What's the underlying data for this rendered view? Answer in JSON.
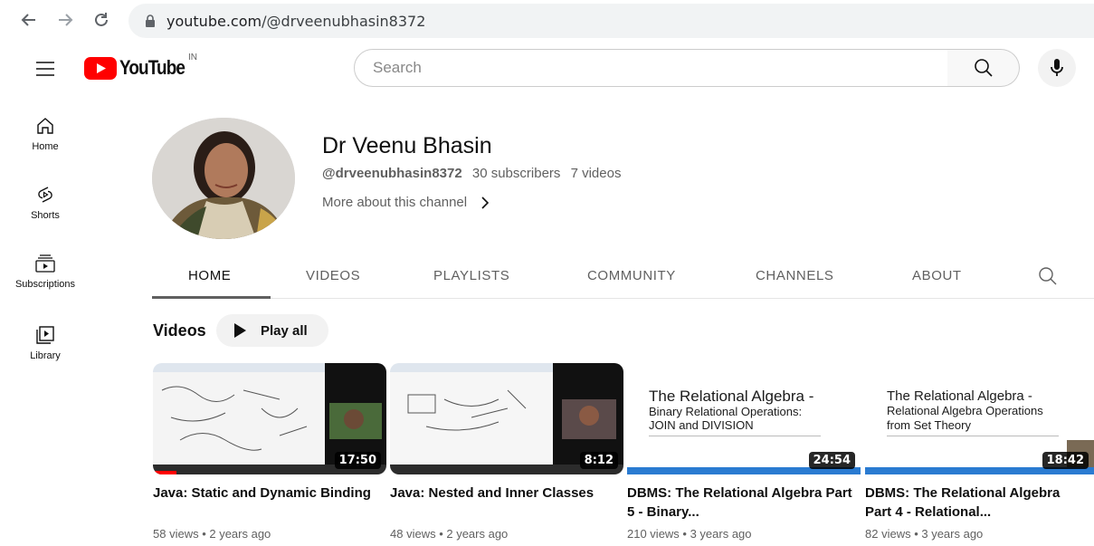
{
  "browser": {
    "url_host": "youtube.com",
    "url_path": "/@drveenubhasin8372"
  },
  "header": {
    "logo_text": "YouTube",
    "country": "IN",
    "search_placeholder": "Search"
  },
  "sidebar": {
    "items": [
      {
        "label": "Home",
        "icon": "home-icon"
      },
      {
        "label": "Shorts",
        "icon": "shorts-icon"
      },
      {
        "label": "Subscriptions",
        "icon": "subscriptions-icon"
      },
      {
        "label": "Library",
        "icon": "library-icon"
      }
    ]
  },
  "channel": {
    "name": "Dr Veenu Bhasin",
    "handle": "@drveenubhasin8372",
    "subscribers": "30 subscribers",
    "videos": "7 videos",
    "more_about": "More about this channel"
  },
  "tabs": [
    {
      "label": "HOME",
      "active": true
    },
    {
      "label": "VIDEOS",
      "active": false
    },
    {
      "label": "PLAYLISTS",
      "active": false
    },
    {
      "label": "COMMUNITY",
      "active": false
    },
    {
      "label": "CHANNELS",
      "active": false
    },
    {
      "label": "ABOUT",
      "active": false
    }
  ],
  "shelf": {
    "title": "Videos",
    "play_all": "Play all"
  },
  "videos": [
    {
      "title": "Java: Static and Dynamic Binding",
      "duration": "17:50",
      "meta": "58 views • 2 years ago",
      "progress": 0.1
    },
    {
      "title": "Java: Nested and Inner Classes",
      "duration": "8:12",
      "meta": "48 views • 2 years ago"
    },
    {
      "title": "DBMS: The Relational Algebra Part 5 - Binary...",
      "duration": "24:54",
      "meta": "210 views • 3 years ago",
      "slide_title": "The Relational Algebra -",
      "slide_sub1": "Binary Relational Operations:",
      "slide_sub2": "JOIN and DIVISION"
    },
    {
      "title": "DBMS: The Relational Algebra Part 4 - Relational...",
      "duration": "18:42",
      "meta": "82 views • 3 years ago",
      "slide_title": "The Relational Algebra -",
      "slide_sub1": "Relational Algebra Operations",
      "slide_sub2": "from Set Theory"
    }
  ],
  "colors": {
    "brand_red": "#ff0000",
    "slide_blue": "#2a7bd1"
  }
}
